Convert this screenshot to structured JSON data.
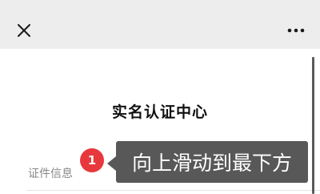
{
  "header": {
    "close_icon": "close-icon",
    "more_icon": "more-horizontal-icon"
  },
  "main": {
    "title": "实名认证中心",
    "field_label": "证件信息"
  },
  "instruction": {
    "step_number": "1",
    "text": "向上滑动到最下方"
  },
  "colors": {
    "nav_bg": "#ededed",
    "badge": "#e8383d",
    "tooltip_bg": "#414141"
  }
}
